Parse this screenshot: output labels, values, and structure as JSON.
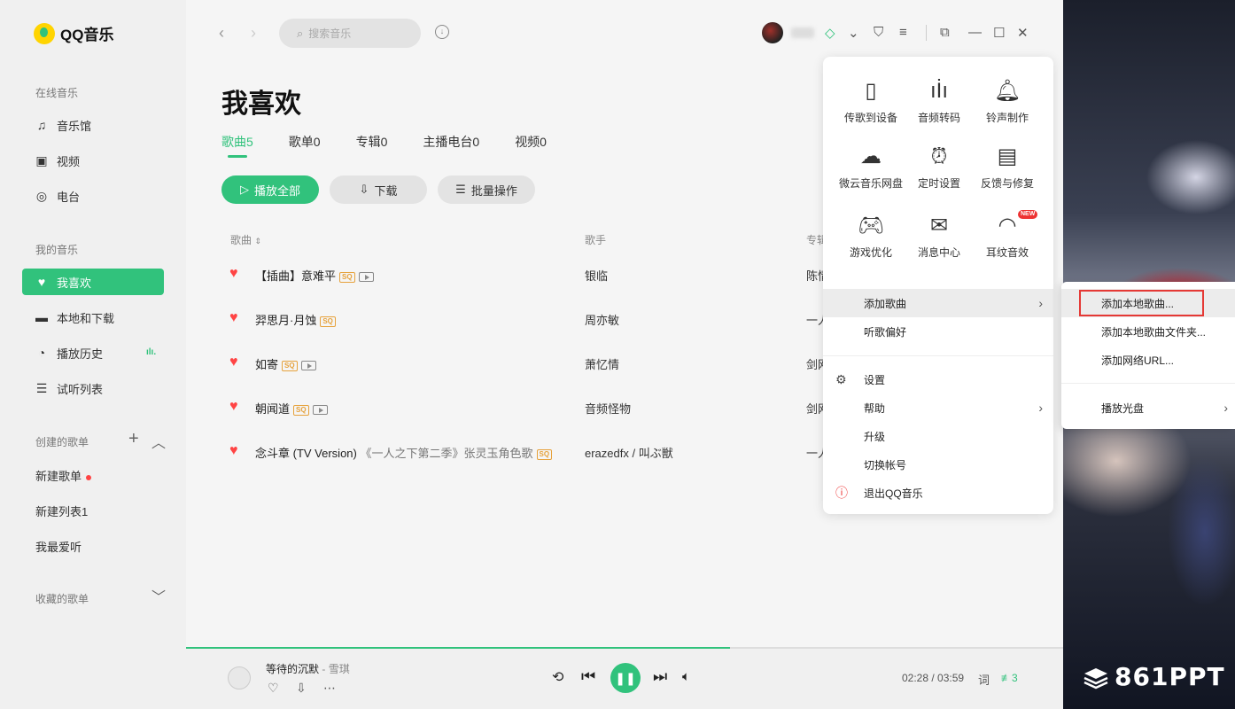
{
  "app": {
    "name": "QQ音乐"
  },
  "sidebar": {
    "online_title": "在线音乐",
    "online_items": [
      {
        "label": "音乐馆",
        "icon": "music-note-icon"
      },
      {
        "label": "视频",
        "icon": "video-icon"
      },
      {
        "label": "电台",
        "icon": "radio-icon"
      }
    ],
    "my_title": "我的音乐",
    "my_items": [
      {
        "label": "我喜欢",
        "icon": "heart-icon"
      },
      {
        "label": "本地和下载",
        "icon": "monitor-icon"
      },
      {
        "label": "播放历史",
        "icon": "clock-icon"
      },
      {
        "label": "试听列表",
        "icon": "list-icon"
      }
    ],
    "created_title": "创建的歌单",
    "created_lists": [
      "新建歌单",
      "新建列表1",
      "我最爱听"
    ],
    "collected_title": "收藏的歌单"
  },
  "topbar": {
    "search_placeholder": "搜索音乐"
  },
  "page": {
    "title": "我喜欢",
    "tabs": [
      "歌曲5",
      "歌单0",
      "专辑0",
      "主播电台0",
      "视频0"
    ],
    "play_all": "播放全部",
    "download": "下载",
    "batch": "批量操作"
  },
  "table": {
    "headers": {
      "song": "歌曲",
      "artist": "歌手",
      "album": "专辑"
    },
    "rows": [
      {
        "song": "【插曲】意难平",
        "artist": "银临",
        "album": "陈情",
        "sq": true,
        "mv": true
      },
      {
        "song": "羿思月·月蚀",
        "artist": "周亦敏",
        "album": "一人",
        "sq": true,
        "mv": false
      },
      {
        "song": "如寄",
        "artist": "萧忆情",
        "album": "剑网",
        "sq": true,
        "mv": true
      },
      {
        "song": "朝闻道",
        "artist": "音频怪物",
        "album": "剑网",
        "sq": true,
        "mv": true
      },
      {
        "song": "念斗章 (TV Version)",
        "sub": "《一人之下第二季》张灵玉角色歌",
        "artist": "erazedfx / 叫ぶ獣",
        "album": "一人",
        "sq": true,
        "mv": false
      }
    ]
  },
  "menu": {
    "grid": [
      {
        "label": "传歌到设备",
        "icon": "phone-icon"
      },
      {
        "label": "音频转码",
        "icon": "waveform-icon"
      },
      {
        "label": "铃声制作",
        "icon": "bell-icon"
      },
      {
        "label": "微云音乐网盘",
        "icon": "cloud-icon"
      },
      {
        "label": "定时设置",
        "icon": "alarm-clock-icon"
      },
      {
        "label": "反馈与修复",
        "icon": "feedback-icon"
      },
      {
        "label": "游戏优化",
        "icon": "gamepad-icon"
      },
      {
        "label": "消息中心",
        "icon": "mail-icon"
      },
      {
        "label": "耳纹音效",
        "icon": "ear-icon",
        "badge": "NEW"
      }
    ],
    "items": [
      "添加歌曲",
      "听歌偏好",
      "设置",
      "帮助",
      "升级",
      "切换帐号",
      "退出QQ音乐"
    ]
  },
  "submenu": {
    "items": [
      "添加本地歌曲...",
      "添加本地歌曲文件夹...",
      "添加网络URL...",
      "播放光盘"
    ]
  },
  "player": {
    "title": "等待的沉默",
    "artist": "雪琪",
    "time": "02:28 / 03:59",
    "lyric": "词",
    "queue_count": "3",
    "progress": 0.62
  },
  "watermark": "861PPT",
  "colors": {
    "accent": "#31c27c",
    "heart": "#ff4444",
    "highlight": "#e53935"
  }
}
